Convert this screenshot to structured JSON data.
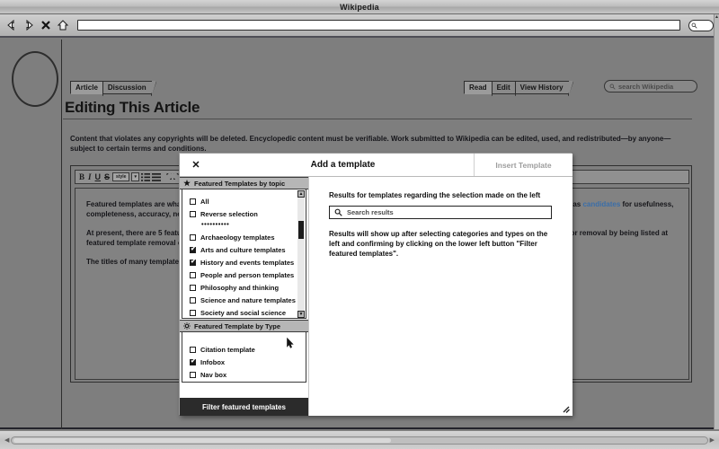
{
  "browser": {
    "title": "Wikipedia",
    "nav": {
      "back": "back-arrow",
      "forward": "forward-arrow",
      "stop": "✕",
      "home": "home-icon"
    },
    "url_value": "",
    "url_placeholder": ""
  },
  "wiki": {
    "page_tabs": [
      {
        "label": "Article",
        "active": true
      },
      {
        "label": "Discussion",
        "active": false
      }
    ],
    "view_tabs": [
      {
        "label": "Read",
        "active": true
      },
      {
        "label": "Edit",
        "active": false
      },
      {
        "label": "View History",
        "active": false
      }
    ],
    "search": {
      "placeholder": "search Wikipedia",
      "value": ""
    },
    "article_title": "Editing This Article",
    "intro_paragraph": "Content that violates any copyrights will be deleted. Encyclopedic content must be verifiable. Work submitted to Wikipedia can be edited, used, and redistributed—by anyone— subject to certain terms and conditions.",
    "editor_toolbar": {
      "bold": "B",
      "italic": "I",
      "underline": "U",
      "strikethrough": "S",
      "style_label": "style",
      "caret": "▾",
      "numbered_list": "list-numbered-icon",
      "bulleted_list": "list-bulleted-icon",
      "undo": "undo-icon",
      "redo": "redo-icon"
    },
    "editor_paragraphs": [
      {
        "pre": "Featured templates are what Wikipedia editors believe to be the best templates on Wikipedia. Before being listed here, templates are reviewed as ",
        "link": "candidates",
        "post": " for usefulness, completeness, accuracy, neutrality, presentation and whether or not they are a featured template"
      },
      {
        "text": "At present, there are 5 featured templates out of 616,575 templates on Wikipedia. Templates that no longer meet the criteria can be proposed for removal by being listed at featured template removal candidates."
      },
      {
        "text": "The titles of many templates are self-descriptive and the templates themselves are in use across the project."
      }
    ]
  },
  "dialog": {
    "close_icon": "✕",
    "title": "Add a template",
    "insert_label": "Insert Template",
    "left": {
      "topic_section": {
        "icon": "star-icon",
        "header": "Featured Templates by topic",
        "items": [
          {
            "label": "All",
            "checked": false
          },
          {
            "label": "Reverse selection",
            "checked": false
          },
          {
            "label": "••••••••••",
            "checked": null,
            "divider": true
          },
          {
            "label": "Archaeology templates",
            "checked": false
          },
          {
            "label": "Arts and culture templates",
            "checked": true
          },
          {
            "label": "History and events templates",
            "checked": true
          },
          {
            "label": "People and person templates",
            "checked": false
          },
          {
            "label": "Philosophy and thinking",
            "checked": false
          },
          {
            "label": "Science and nature templates",
            "checked": false
          },
          {
            "label": "Society and social science",
            "checked": false
          }
        ],
        "scroll_up": "▲",
        "scroll_down": "▼"
      },
      "type_section": {
        "icon": "gear-icon",
        "header": "Featured Template by Type",
        "items": [
          {
            "label": "Citation template",
            "checked": false
          },
          {
            "label": "Infobox",
            "checked": true
          },
          {
            "label": "Nav box",
            "checked": false
          }
        ]
      },
      "filter_button": "Filter featured templates"
    },
    "right": {
      "heading": "Results for templates regarding the selection made on the left",
      "search_placeholder": "Search results",
      "search_value": "",
      "body": "Results will show up after selecting categories and types on the left and confirming by clicking on the lower left button \"Filter featured templates\"."
    }
  },
  "colors": {
    "page_bg": "#7e7e7e",
    "dialog_bg": "#ffffff",
    "filter_button_bg": "#2b2b2b",
    "link": "#3b6ea8",
    "section_header_bg": "#b6b6b6"
  }
}
